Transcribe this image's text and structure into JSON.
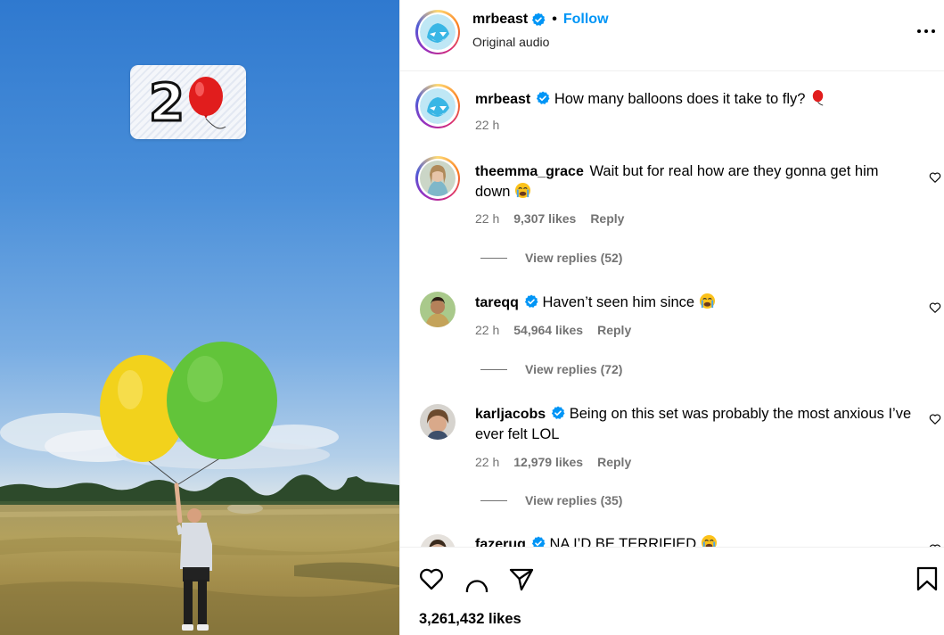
{
  "media": {
    "counter": "2",
    "balloon_icon": "red-balloon-emoji",
    "colors": {
      "sky": "#2f79cf",
      "yellow_balloon": "#f2d21c",
      "green_balloon": "#62c43a"
    }
  },
  "post": {
    "author": "mrbeast",
    "follow_label": "Follow",
    "subtitle": "Original audio",
    "caption": {
      "username": "mrbeast",
      "text": "How many balloons does it take to fly?",
      "time": "22 h"
    },
    "likes": "3,261,432 likes"
  },
  "comments": [
    {
      "username": "theemma_grace",
      "verified": false,
      "text": "Wait but for real how are they gonna get him down",
      "emoji": "crying-face",
      "time": "22 h",
      "likes": "9,307 likes",
      "reply": "Reply",
      "view_replies": "View replies (52)"
    },
    {
      "username": "tareqq",
      "verified": true,
      "text": "Haven’t seen him since",
      "emoji": "crying-face",
      "time": "22 h",
      "likes": "54,964 likes",
      "reply": "Reply",
      "view_replies": "View replies (72)"
    },
    {
      "username": "karljacobs",
      "verified": true,
      "text": "Being on this set was probably the most anxious I’ve ever felt LOL",
      "emoji": "",
      "time": "22 h",
      "likes": "12,979 likes",
      "reply": "Reply",
      "view_replies": "View replies (35)"
    },
    {
      "username": "fazerug",
      "verified": true,
      "text": "NA I’D BE TERRIFIED",
      "emoji": "crying-face"
    }
  ],
  "colors": {
    "accent": "#0095f6",
    "verified": "#0095f6",
    "muted": "#737373"
  }
}
